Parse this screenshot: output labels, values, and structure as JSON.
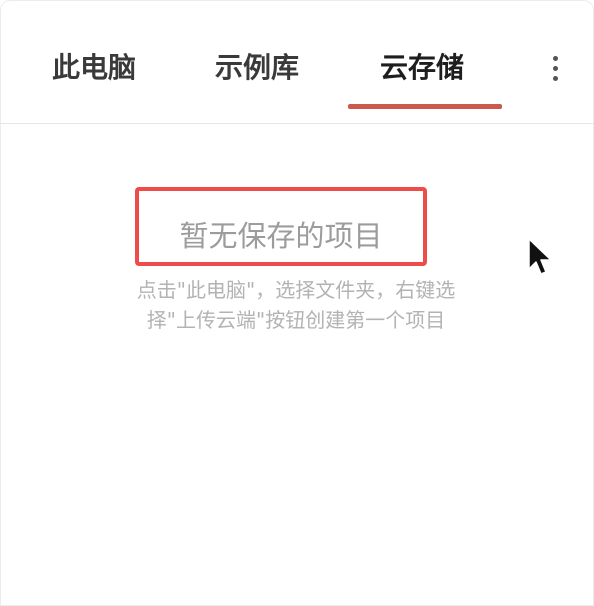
{
  "tabs": [
    {
      "label": "此电脑",
      "active": false
    },
    {
      "label": "示例库",
      "active": false
    },
    {
      "label": "云存储",
      "active": true
    }
  ],
  "more_menu_icon": "vertical-ellipsis-icon",
  "empty_state": {
    "title": "暂无保存的项目",
    "hint_line1": "点击\"此电脑\"，选择文件夹，右键选",
    "hint_line2": "择\"上传云端\"按钮创建第一个项目"
  },
  "colors": {
    "active_tab_underline": "#cc5a4a",
    "highlight_border": "#ee4b4b",
    "empty_title_text": "#9c9c9c",
    "hint_text": "#b3b3b3"
  }
}
